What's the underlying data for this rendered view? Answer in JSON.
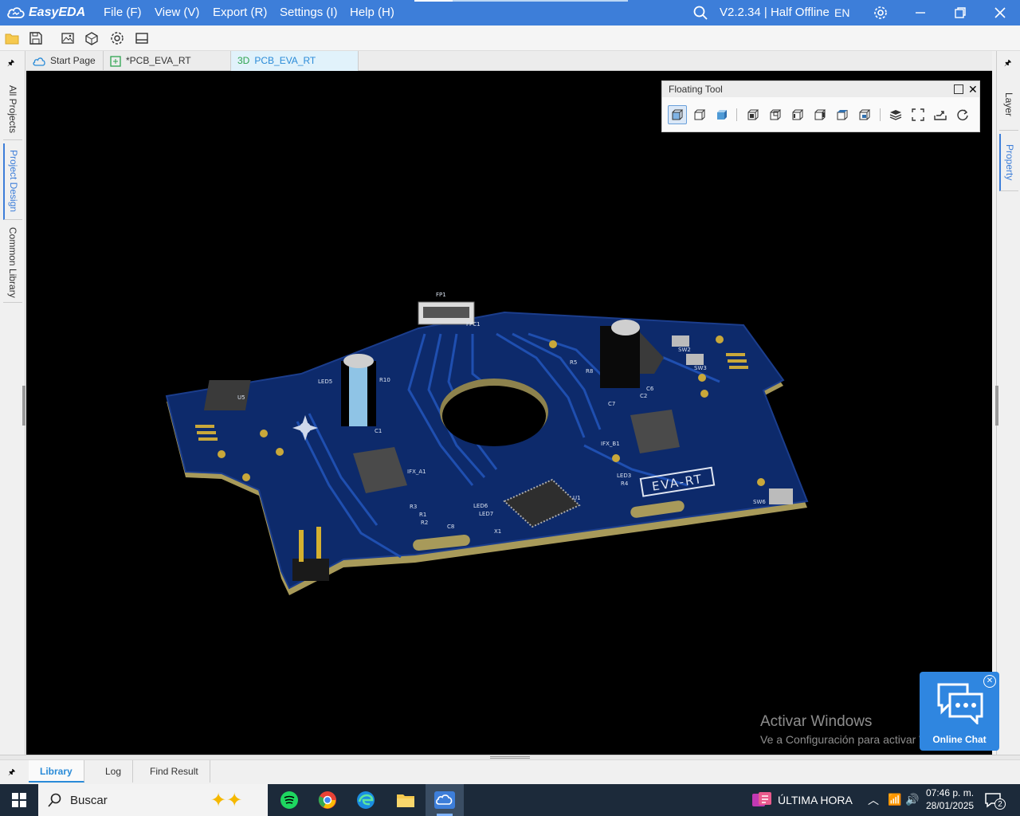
{
  "titlebar": {
    "brand": "EasyEDA",
    "menus": [
      "File (F)",
      "View (V)",
      "Export (R)",
      "Settings (I)",
      "Help (H)"
    ],
    "version": "V2.2.34 | Half Offline",
    "lang": "EN"
  },
  "toolbar": {
    "icons": [
      "folder-icon",
      "save-icon",
      "image-export-icon",
      "3d-model-icon",
      "settings-icon",
      "panel-icon"
    ]
  },
  "left_panel": {
    "tabs": [
      "All Projects",
      "Project Design",
      "Common Library"
    ],
    "active_tab": "Project Design"
  },
  "right_panel": {
    "tabs": [
      "Layer",
      "Property"
    ],
    "active_tab": "Property"
  },
  "doc_tabs": [
    {
      "label": "Start Page",
      "icon": "cloud-icon"
    },
    {
      "label": "*PCB_EVA_RT",
      "icon": "pcb-icon"
    },
    {
      "label": "PCB_EVA_RT",
      "prefix": "3D"
    }
  ],
  "active_doc_tab": 2,
  "floating_tool": {
    "title": "Floating Tool",
    "buttons": [
      "cube-solid-icon",
      "cube-wire-icon",
      "cube-shaded-icon",
      "view-front-icon",
      "view-back-icon",
      "view-left-icon",
      "view-right-icon",
      "view-top-icon",
      "view-bottom-icon",
      "layers-icon",
      "fit-view-icon",
      "export-icon",
      "refresh-icon"
    ]
  },
  "pcb_labels": {
    "silk": "EVA-RT",
    "components": [
      "U5",
      "LED5",
      "R10",
      "C1",
      "IFX_A1",
      "R3",
      "R1",
      "R2",
      "C8",
      "LED6",
      "LED7",
      "X1",
      "U1",
      "LED3",
      "R4",
      "IFX_B1",
      "C2",
      "C6",
      "C7",
      "SW2",
      "SW3",
      "SW6",
      "R5",
      "R8",
      "FPC1",
      "FP1"
    ]
  },
  "watermark": {
    "line1": "Activar Windows",
    "line2": "Ve a Configuración para activar Windows."
  },
  "chat": {
    "label": "Online Chat"
  },
  "bottom_panel": {
    "tabs": [
      "Library",
      "Log",
      "Find Result"
    ],
    "active_tab": "Library"
  },
  "taskbar": {
    "search_placeholder": "Buscar",
    "news": "ÚLTIMA HORA",
    "time": "07:46 p. m.",
    "date": "28/01/2025",
    "notif_count": "2"
  },
  "colors": {
    "titlebar": "#3d7ed9",
    "pcb": "#0d2a6b",
    "canvas": "#000000",
    "accent": "#2a8bd8"
  }
}
